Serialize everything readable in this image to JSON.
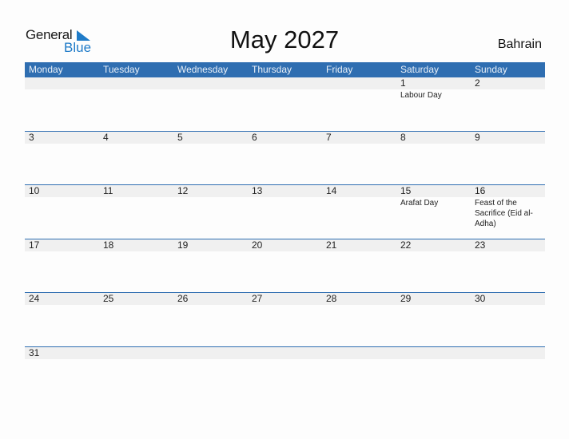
{
  "logo": {
    "word1": "General",
    "word2": "Blue"
  },
  "title": "May 2027",
  "country": "Bahrain",
  "colors": {
    "header_bg": "#2f6eb1",
    "date_band": "#f0f0f0",
    "brand_blue": "#1f7bc8"
  },
  "weekdays": [
    "Monday",
    "Tuesday",
    "Wednesday",
    "Thursday",
    "Friday",
    "Saturday",
    "Sunday"
  ],
  "weeks": [
    [
      {
        "day": "",
        "event": ""
      },
      {
        "day": "",
        "event": ""
      },
      {
        "day": "",
        "event": ""
      },
      {
        "day": "",
        "event": ""
      },
      {
        "day": "",
        "event": ""
      },
      {
        "day": "1",
        "event": "Labour Day"
      },
      {
        "day": "2",
        "event": ""
      }
    ],
    [
      {
        "day": "3",
        "event": ""
      },
      {
        "day": "4",
        "event": ""
      },
      {
        "day": "5",
        "event": ""
      },
      {
        "day": "6",
        "event": ""
      },
      {
        "day": "7",
        "event": ""
      },
      {
        "day": "8",
        "event": ""
      },
      {
        "day": "9",
        "event": ""
      }
    ],
    [
      {
        "day": "10",
        "event": ""
      },
      {
        "day": "11",
        "event": ""
      },
      {
        "day": "12",
        "event": ""
      },
      {
        "day": "13",
        "event": ""
      },
      {
        "day": "14",
        "event": ""
      },
      {
        "day": "15",
        "event": "Arafat Day"
      },
      {
        "day": "16",
        "event": "Feast of the Sacrifice (Eid al-Adha)"
      }
    ],
    [
      {
        "day": "17",
        "event": ""
      },
      {
        "day": "18",
        "event": ""
      },
      {
        "day": "19",
        "event": ""
      },
      {
        "day": "20",
        "event": ""
      },
      {
        "day": "21",
        "event": ""
      },
      {
        "day": "22",
        "event": ""
      },
      {
        "day": "23",
        "event": ""
      }
    ],
    [
      {
        "day": "24",
        "event": ""
      },
      {
        "day": "25",
        "event": ""
      },
      {
        "day": "26",
        "event": ""
      },
      {
        "day": "27",
        "event": ""
      },
      {
        "day": "28",
        "event": ""
      },
      {
        "day": "29",
        "event": ""
      },
      {
        "day": "30",
        "event": ""
      }
    ],
    [
      {
        "day": "31",
        "event": ""
      },
      {
        "day": "",
        "event": ""
      },
      {
        "day": "",
        "event": ""
      },
      {
        "day": "",
        "event": ""
      },
      {
        "day": "",
        "event": ""
      },
      {
        "day": "",
        "event": ""
      },
      {
        "day": "",
        "event": ""
      }
    ]
  ]
}
